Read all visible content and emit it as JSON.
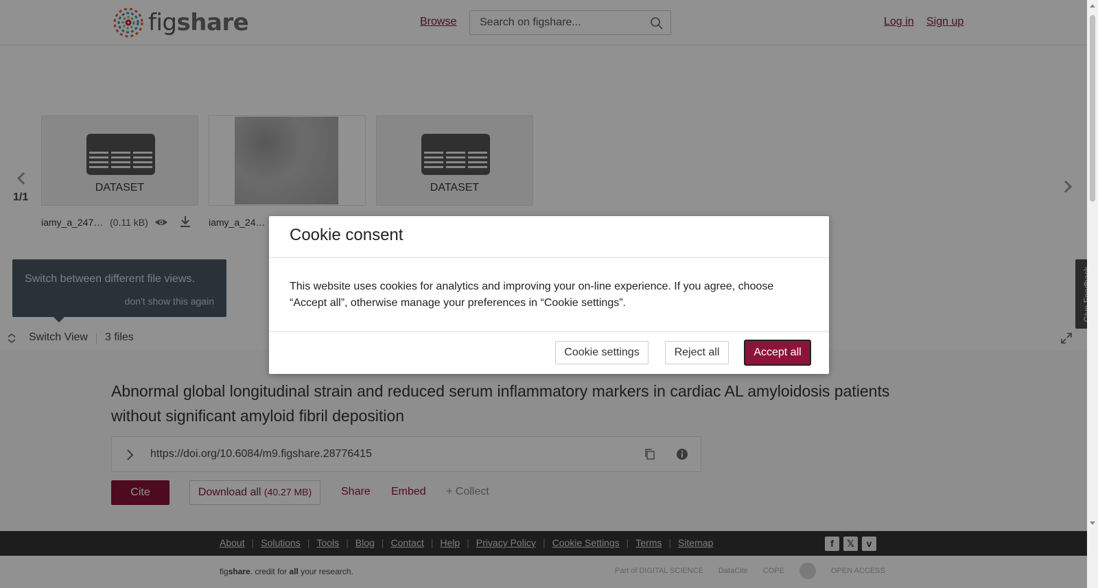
{
  "header": {
    "logo_text": "figshare",
    "browse_label": "Browse",
    "search_placeholder": "Search on figshare...",
    "login_label": "Log in",
    "signup_label": "Sign up"
  },
  "viewer": {
    "pager": "1/1",
    "files": [
      {
        "type_label": "DATASET",
        "name": "iamy_a_247…",
        "size": "(0.11 kB)"
      },
      {
        "type_label": "",
        "name": "iamy_a_24…",
        "size": ""
      },
      {
        "type_label": "DATASET",
        "name": "",
        "size": ""
      }
    ],
    "tooltip": {
      "text": "Switch between different file views.",
      "dismiss": "don't show this again"
    },
    "switch_view_label": "Switch View",
    "files_count": "3 files",
    "feedback_label": "Give Feedback"
  },
  "article": {
    "title": "Abnormal global longitudinal strain and reduced serum inflammatory markers in cardiac AL amyloidosis patients without significant amyloid fibril deposition",
    "doi": "https://doi.org/10.6084/m9.figshare.28776415",
    "cite_label": "Cite",
    "download_label": "Download all",
    "download_size": "(40.27 MB)",
    "share_label": "Share",
    "embed_label": "Embed",
    "collect_label": "+ Collect"
  },
  "footer": {
    "links": [
      "About",
      "Solutions",
      "Tools",
      "Blog",
      "Contact",
      "Help",
      "Privacy Policy",
      "Cookie Settings",
      "Terms",
      "Sitemap"
    ],
    "tagline_pre": "fig",
    "tagline_brand": "share",
    "tagline_mid": ". credit for ",
    "tagline_all": "all",
    "tagline_post": " your research.",
    "partners": [
      "Part of DIGITAL SCIENCE",
      "DataCite",
      "COPE",
      "",
      "OPEN ACCESS"
    ]
  },
  "cookie_modal": {
    "title": "Cookie consent",
    "body": "This website uses cookies for analytics and improving your on-line experience. If you agree, choose “Accept all”, otherwise manage your preferences in “Cookie settings”.",
    "settings_label": "Cookie settings",
    "reject_label": "Reject all",
    "accept_label": "Accept all"
  },
  "colors": {
    "brand": "#8a1538",
    "footer_dark": "#333333",
    "overlay": "rgba(0,0,0,0.43)"
  }
}
